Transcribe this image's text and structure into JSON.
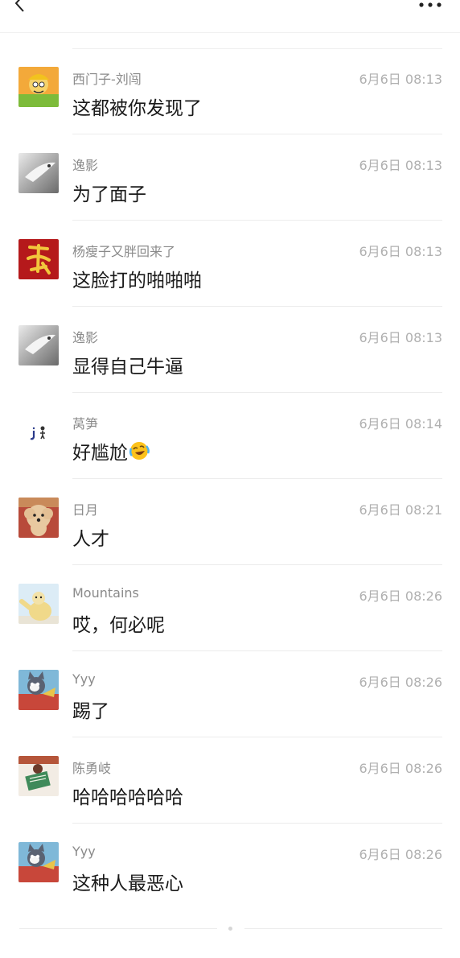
{
  "header": {
    "back_icon": "chevron-left-icon",
    "more_icon": "more-dots-icon"
  },
  "comments": [
    {
      "name": "西门子-刘闯",
      "time": "6月6日 08:13",
      "text": "这都被你发现了",
      "avatar": "cartoon-worker-avatar"
    },
    {
      "name": "逸影",
      "time": "6月6日 08:13",
      "text": "为了面子",
      "avatar": "gray-bird-avatar"
    },
    {
      "name": "杨瘦子又胖回来了",
      "time": "6月6日 08:13",
      "text": "这脸打的啪啪啪",
      "avatar": "red-calligraphy-avatar"
    },
    {
      "name": "逸影",
      "time": "6月6日 08:13",
      "text": "显得自己牛逼",
      "avatar": "gray-bird-avatar"
    },
    {
      "name": "莴笋",
      "time": "6月6日 08:14",
      "text": "好尴尬",
      "avatar": "small-figure-avatar",
      "emoji": "laughing-crying-emoji"
    },
    {
      "name": "日月",
      "time": "6月6日 08:21",
      "text": "人才",
      "avatar": "poodle-avatar"
    },
    {
      "name": "Mountains",
      "time": "6月6日 08:26",
      "text": "哎，何必呢",
      "avatar": "polar-bear-avatar"
    },
    {
      "name": "Yyy",
      "time": "6月6日 08:26",
      "text": "踢了",
      "avatar": "tom-cat-avatar"
    },
    {
      "name": "陈勇岐",
      "time": "6月6日 08:26",
      "text": "哈哈哈哈哈哈",
      "avatar": "reading-person-avatar"
    },
    {
      "name": "Yyy",
      "time": "6月6日 08:26",
      "text": "这种人最恶心",
      "avatar": "tom-cat-avatar"
    }
  ]
}
